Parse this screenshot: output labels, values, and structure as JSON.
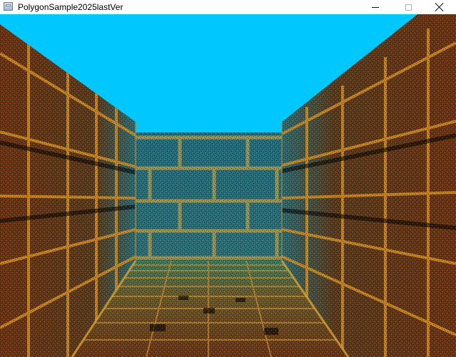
{
  "window": {
    "title": "PolygonSample2025lastVer"
  },
  "icons": {
    "app": "app-window-icon",
    "minimize": "minimize-icon",
    "maximize": "maximize-icon",
    "close": "close-icon"
  },
  "scene": {
    "sky_color": "#00c8ff",
    "brick_color": "#7a3a12",
    "mortar_color": "#d88a1e",
    "fog_color": "#1e7a8a"
  }
}
